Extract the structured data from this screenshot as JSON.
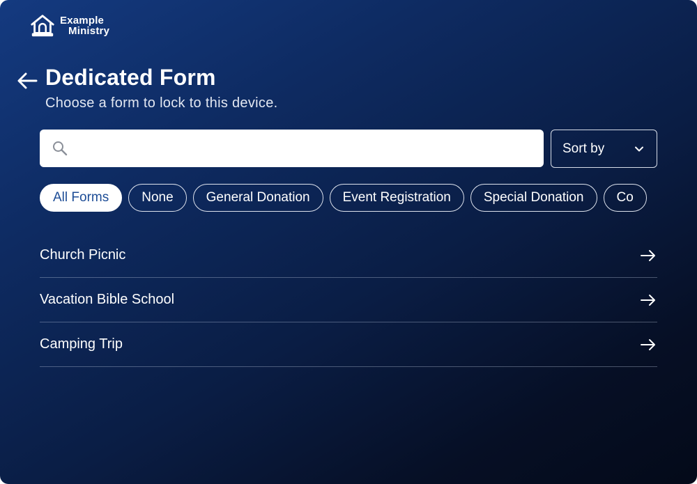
{
  "brand": {
    "line1": "Example",
    "line2": "Ministry",
    "icon": "church-building-icon"
  },
  "header": {
    "title": "Dedicated Form",
    "subtitle": "Choose a form to lock to this device.",
    "back_icon": "arrow-left-icon"
  },
  "search": {
    "placeholder": "",
    "value": "",
    "icon": "search-icon"
  },
  "sort": {
    "label": "Sort by",
    "icon": "chevron-down-icon"
  },
  "filters": [
    {
      "label": "All Forms",
      "active": true
    },
    {
      "label": "None",
      "active": false
    },
    {
      "label": "General Donation",
      "active": false
    },
    {
      "label": "Event Registration",
      "active": false
    },
    {
      "label": "Special Donation",
      "active": false
    },
    {
      "label": "Co",
      "active": false
    }
  ],
  "forms": [
    {
      "label": "Church Picnic",
      "icon": "arrow-right-icon"
    },
    {
      "label": "Vacation Bible School",
      "icon": "arrow-right-icon"
    },
    {
      "label": "Camping Trip",
      "icon": "arrow-right-icon"
    }
  ],
  "colors": {
    "accent": "#1c4c96",
    "bg_top": "#143a80",
    "bg_bottom": "#040a19"
  }
}
